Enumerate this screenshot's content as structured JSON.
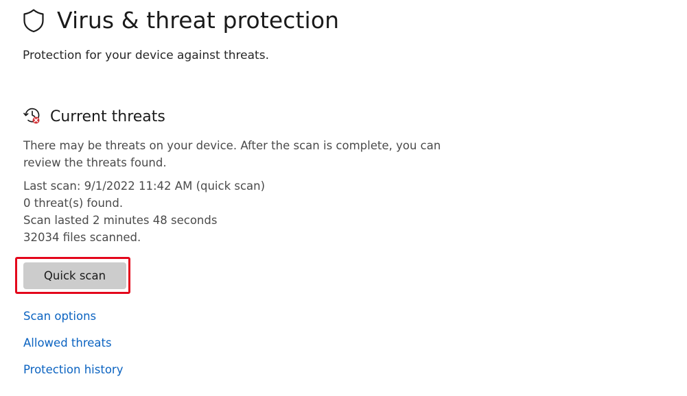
{
  "page": {
    "title": "Virus & threat protection",
    "subtitle": "Protection for your device against threats.",
    "icon": "shield-icon"
  },
  "current_threats": {
    "title": "Current threats",
    "icon": "history-alert-icon",
    "description": "There may be threats on your device. After the scan is complete, you can review the threats found.",
    "last_scan": "Last scan: 9/1/2022 11:42 AM (quick scan)",
    "threats_found": "0 threat(s) found.",
    "scan_duration": "Scan lasted 2 minutes 48 seconds",
    "files_scanned": "32034 files scanned.",
    "quick_scan_label": "Quick scan"
  },
  "links": {
    "scan_options": "Scan options",
    "allowed_threats": "Allowed threats",
    "protection_history": "Protection history"
  },
  "colors": {
    "link": "#0b63c1",
    "highlight": "#e3061b",
    "button_bg": "#cccccc",
    "status_badge": "#d13438"
  }
}
